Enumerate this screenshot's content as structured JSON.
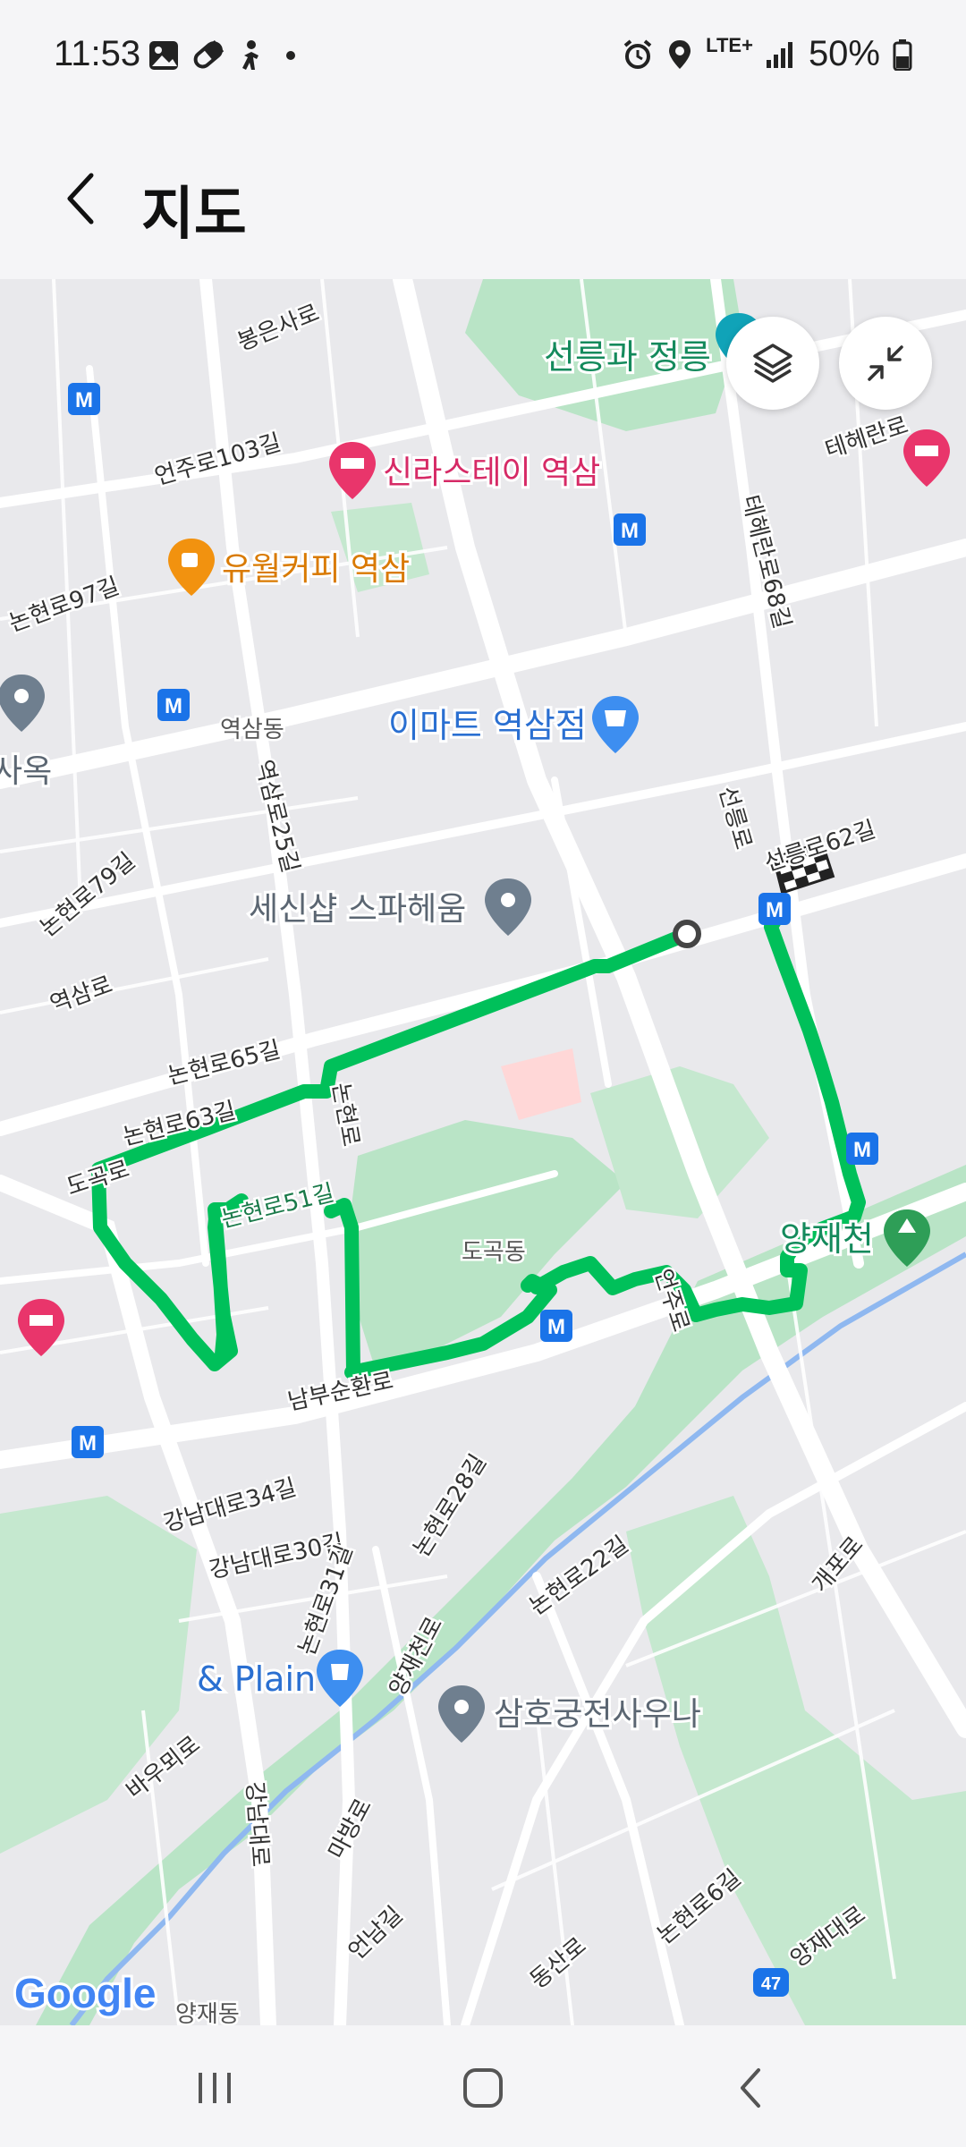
{
  "status_bar": {
    "time": "11:53",
    "network": "LTE+",
    "battery": "50%",
    "left_icons": [
      "gallery-icon",
      "pill-icon",
      "accessibility-icon",
      "dot-icon"
    ],
    "right_icons": [
      "alarm-icon",
      "location-icon",
      "signal-icon",
      "battery-icon"
    ]
  },
  "header": {
    "title": "지도",
    "back_icon": "chevron-left-icon"
  },
  "map": {
    "controls": {
      "layers_icon": "layers-icon",
      "collapse_icon": "collapse-icon"
    },
    "route_color": "#00c05a",
    "attribution": "Google",
    "places": {
      "royal_tomb": "선릉과 정릉",
      "hotel": "신라스테이 역삼",
      "cafe": "유월커피 역삼",
      "emart": "이마트 역삼점",
      "spa": "세신샵 스파헤움",
      "stream": "양재천",
      "plain": "& Plain",
      "sauna": "삼호궁전사우나",
      "partial_left": "사옥"
    },
    "streets": {
      "bongeunsa": "봉은사로",
      "eonju103": "언주로103길",
      "teheran": "테헤란로",
      "teheran68": "테헤란로68길",
      "nonhyeon97": "논현로97길",
      "yeoksamdong": "역삼동",
      "yeoksam25": "역삼로25길",
      "seolleung": "선릉로",
      "seolleung62": "선릉로62길",
      "nonhyeon79": "논현로79길",
      "yeoksamro": "역삼로",
      "nonhyeon65": "논현로65길",
      "nonhyeon63": "논현로63길",
      "dogok_ro": "도곡로",
      "nonhyeon_ro": "논현로",
      "nonhyeon51": "논현로51길",
      "dogokdong": "도곡동",
      "eonju_ro": "언주로",
      "nambu": "남부순환로",
      "gangnam34": "강남대로34길",
      "gangnam30": "강남대로30길",
      "nonhyeon28": "논현로28길",
      "nonhyeon31": "논현로31길",
      "yangjaecheon_ro": "양재천로",
      "nonhyeon22": "논현로22길",
      "gaepo": "개포로",
      "baeumoe": "바우뫼로",
      "gangnam_daero": "강남대로",
      "mabang": "마방로",
      "eonnam": "언남길",
      "dongsan": "동산로",
      "nonhyeon6": "논현로6길",
      "yangjae_daero": "양재대로",
      "yangjaedong": "양재동",
      "route47": "47"
    }
  },
  "nav_bar": {
    "recent_icon": "recent-apps-icon",
    "home_icon": "home-icon",
    "back_icon": "back-icon"
  }
}
